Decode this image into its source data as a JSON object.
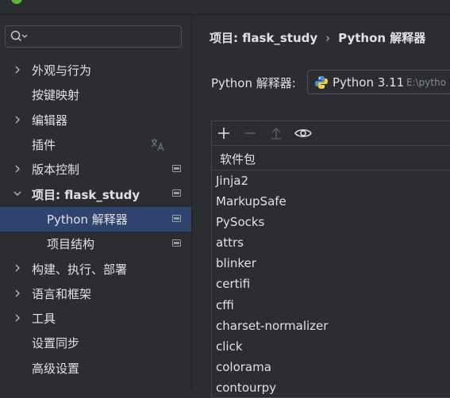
{
  "sidebar": {
    "search": {
      "value": "",
      "placeholder": ""
    },
    "items": [
      {
        "label": "外观与行为"
      },
      {
        "label": "按键映射"
      },
      {
        "label": "编辑器"
      },
      {
        "label": "插件"
      },
      {
        "label": "版本控制"
      },
      {
        "label": "项目: flask_study"
      },
      {
        "label": "Python 解释器"
      },
      {
        "label": "项目结构"
      },
      {
        "label": "构建、执行、部署"
      },
      {
        "label": "语言和框架"
      },
      {
        "label": "工具"
      },
      {
        "label": "设置同步"
      },
      {
        "label": "高级设置"
      }
    ]
  },
  "main": {
    "breadcrumb": {
      "project": "项目: flask_study",
      "separator": "›",
      "page": "Python 解释器"
    },
    "interpreter_label": "Python 解释器:",
    "interpreter": {
      "name": "Python 3.11",
      "path": "E:\\pytho"
    },
    "packages_header": "软件包",
    "packages": [
      "Jinja2",
      "MarkupSafe",
      "PySocks",
      "attrs",
      "blinker",
      "certifi",
      "cffi",
      "charset-normalizer",
      "click",
      "colorama",
      "contourpy"
    ]
  },
  "colors": {
    "background": "#2b2d30",
    "selection": "#2e436e",
    "text": "#dfe1e5",
    "muted": "#868a91",
    "border": "#43454a"
  },
  "icons": [
    "chevron-right-icon",
    "chevron-down-icon",
    "search-icon",
    "translate-icon",
    "project-level-icon",
    "python-icon",
    "add-icon",
    "remove-icon",
    "upgrade-icon",
    "eye-icon"
  ]
}
